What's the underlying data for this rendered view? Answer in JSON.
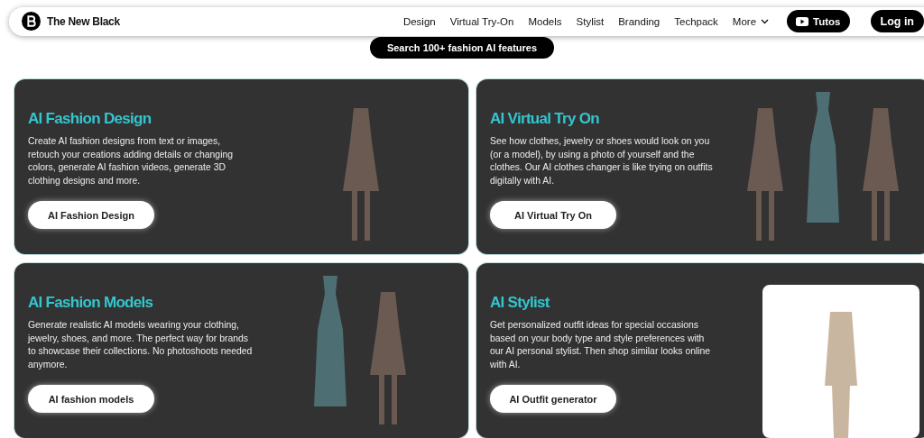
{
  "nav": {
    "brand": "The New Black",
    "links": [
      {
        "label": "Design",
        "kind": "link"
      },
      {
        "label": "Virtual Try-On",
        "kind": "link"
      },
      {
        "label": "Models",
        "kind": "link"
      },
      {
        "label": "Stylist",
        "kind": "link"
      },
      {
        "label": "Branding",
        "kind": "link"
      },
      {
        "label": "Techpack",
        "kind": "link"
      },
      {
        "label": "More",
        "kind": "dropdown"
      }
    ],
    "tutos": "Tutos",
    "login": "Log in"
  },
  "search_button": "Search 100+ fashion AI features",
  "cards": [
    {
      "title": "AI Fashion Design",
      "description": "Create AI fashion designs from text or images, retouch your creations adding details or changing colors, generate AI fashion videos, generate 3D clothing designs and more.",
      "button": "AI Fashion Design",
      "photos": [
        {
          "kind": "model"
        }
      ]
    },
    {
      "title": "AI Virtual Try On",
      "description": "See how clothes, jewelry or shoes would look on you (or a model), by using a photo of yourself and the clothes. Our AI clothes changer is like trying on outfits digitally with AI.",
      "button": "AI Virtual Try On",
      "photos": [
        {
          "kind": "model"
        },
        {
          "kind": "garment"
        },
        {
          "kind": "model"
        }
      ]
    },
    {
      "title": "AI Fashion Models",
      "description": "Generate realistic AI models wearing your clothing, jewelry, shoes, and more. The perfect way for brands to showcase their collections. No photoshoots needed anymore.",
      "button": "AI fashion models",
      "photos": [
        {
          "kind": "garment"
        },
        {
          "kind": "model"
        }
      ]
    },
    {
      "title": "AI Stylist",
      "description": "Get personalized outfit ideas for special occasions based on your body type and style preferences with our AI personal stylist. Then shop similar looks online with AI.",
      "button": "AI Outfit generator",
      "photos": [
        {
          "kind": "framed"
        }
      ]
    }
  ]
}
